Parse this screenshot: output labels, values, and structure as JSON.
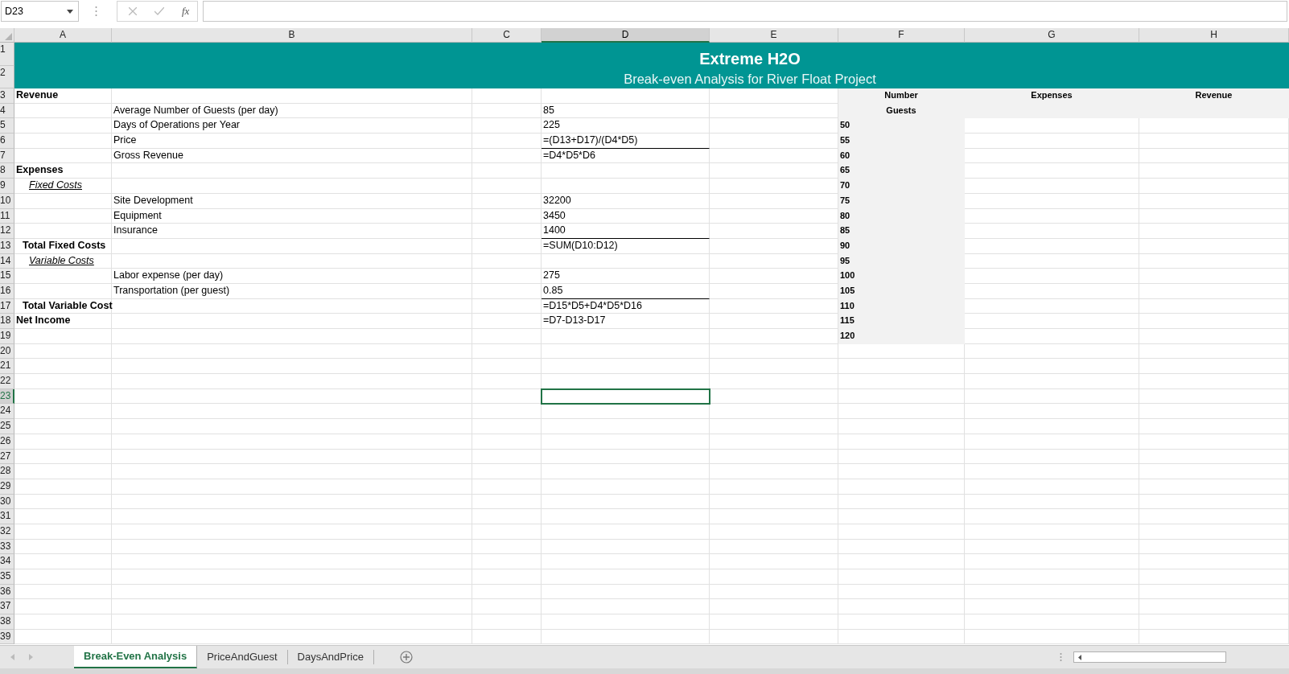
{
  "formula_bar": {
    "name_box": "D23",
    "function_label": "fx"
  },
  "sheet": {
    "title": "Extreme H2O",
    "subtitle": "Break-even Analysis for River Float Project",
    "columns": [
      {
        "letter": "A",
        "selected": false
      },
      {
        "letter": "B",
        "selected": false
      },
      {
        "letter": "C",
        "selected": false
      },
      {
        "letter": "D",
        "selected": true
      },
      {
        "letter": "E",
        "selected": false
      },
      {
        "letter": "F",
        "selected": false
      },
      {
        "letter": "G",
        "selected": false
      },
      {
        "letter": "H",
        "selected": false
      }
    ],
    "rows": [
      {
        "number": "1",
        "selected": false
      },
      {
        "number": "2",
        "selected": false
      },
      {
        "number": "3",
        "selected": false,
        "cells": {
          "A": {
            "text": "Revenue",
            "kind": "heading",
            "bottom_border": false
          },
          "F": {
            "text": "Number",
            "kind": "column_header",
            "bottom_border": false
          },
          "G": {
            "text": "Expenses",
            "kind": "column_header",
            "bottom_border": false
          },
          "H": {
            "text": "Revenue",
            "kind": "column_header",
            "bottom_border": false
          }
        }
      },
      {
        "number": "4",
        "selected": false,
        "cells": {
          "B": {
            "text": "Average Number of Guests (per day)",
            "bottom_border": false
          },
          "D": {
            "text": "85",
            "bottom_border": false
          },
          "F": {
            "text": "Guests",
            "kind": "column_header",
            "bottom_border": false
          }
        }
      },
      {
        "number": "5",
        "selected": false,
        "cells": {
          "B": {
            "text": "Days of Operations per Year",
            "bottom_border": false
          },
          "D": {
            "text": "225",
            "bottom_border": false
          },
          "F": {
            "text": "50",
            "kind": "guest_count",
            "bottom_border": false
          }
        }
      },
      {
        "number": "6",
        "selected": false,
        "cells": {
          "B": {
            "text": "Price",
            "bottom_border": false
          },
          "D": {
            "text": "=(D13+D17)/(D4*D5)",
            "bottom_border": true
          },
          "F": {
            "text": "55",
            "kind": "guest_count",
            "bottom_border": false
          }
        }
      },
      {
        "number": "7",
        "selected": false,
        "cells": {
          "B": {
            "text": "Gross Revenue",
            "bottom_border": false
          },
          "D": {
            "text": "=D4*D5*D6",
            "bottom_border": false
          },
          "F": {
            "text": "60",
            "kind": "guest_count",
            "bottom_border": false
          }
        }
      },
      {
        "number": "8",
        "selected": false,
        "cells": {
          "A": {
            "text": "Expenses",
            "kind": "heading",
            "bottom_border": false
          },
          "F": {
            "text": "65",
            "kind": "guest_count",
            "bottom_border": false
          }
        }
      },
      {
        "number": "9",
        "selected": false,
        "cells": {
          "A": {
            "text": "Fixed Costs",
            "kind": "section",
            "bottom_border": false
          },
          "F": {
            "text": "70",
            "kind": "guest_count",
            "bottom_border": false
          }
        }
      },
      {
        "number": "10",
        "selected": false,
        "cells": {
          "B": {
            "text": "Site Development",
            "bottom_border": false
          },
          "D": {
            "text": "32200",
            "bottom_border": false
          },
          "F": {
            "text": "75",
            "kind": "guest_count",
            "bottom_border": false
          }
        }
      },
      {
        "number": "11",
        "selected": false,
        "cells": {
          "B": {
            "text": "Equipment",
            "bottom_border": false
          },
          "D": {
            "text": "3450",
            "bottom_border": false
          },
          "F": {
            "text": "80",
            "kind": "guest_count",
            "bottom_border": false
          }
        }
      },
      {
        "number": "12",
        "selected": false,
        "cells": {
          "B": {
            "text": "Insurance",
            "bottom_border": false
          },
          "D": {
            "text": "1400",
            "bottom_border": true
          },
          "F": {
            "text": "85",
            "kind": "guest_count",
            "bottom_border": false
          }
        }
      },
      {
        "number": "13",
        "selected": false,
        "cells": {
          "A": {
            "text": "Total Fixed Costs",
            "kind": "subtotal",
            "bottom_border": false
          },
          "D": {
            "text": "=SUM(D10:D12)",
            "bottom_border": false
          },
          "F": {
            "text": "90",
            "kind": "guest_count",
            "bottom_border": false
          }
        }
      },
      {
        "number": "14",
        "selected": false,
        "cells": {
          "A": {
            "text": "Variable Costs",
            "kind": "section",
            "bottom_border": false
          },
          "F": {
            "text": "95",
            "kind": "guest_count",
            "bottom_border": false
          }
        }
      },
      {
        "number": "15",
        "selected": false,
        "cells": {
          "B": {
            "text": "Labor expense (per day)",
            "bottom_border": false
          },
          "D": {
            "text": "275",
            "bottom_border": false
          },
          "F": {
            "text": "100",
            "kind": "guest_count",
            "bottom_border": false
          }
        }
      },
      {
        "number": "16",
        "selected": false,
        "cells": {
          "B": {
            "text": "Transportation (per guest)",
            "bottom_border": false
          },
          "D": {
            "text": "0.85",
            "bottom_border": true
          },
          "F": {
            "text": "105",
            "kind": "guest_count",
            "bottom_border": false
          }
        }
      },
      {
        "number": "17",
        "selected": false,
        "cells": {
          "A": {
            "text": "Total Variable Cost",
            "kind": "subtotal",
            "bottom_border": false
          },
          "D": {
            "text": "=D15*D5+D4*D5*D16",
            "bottom_border": false
          },
          "F": {
            "text": "110",
            "kind": "guest_count",
            "bottom_border": false
          }
        }
      },
      {
        "number": "18",
        "selected": false,
        "cells": {
          "A": {
            "text": "Net Income",
            "kind": "heading",
            "bottom_border": false
          },
          "D": {
            "text": "=D7-D13-D17",
            "bottom_border": false
          },
          "F": {
            "text": "115",
            "kind": "guest_count",
            "bottom_border": false
          }
        }
      },
      {
        "number": "19",
        "selected": false,
        "cells": {
          "F": {
            "text": "120",
            "kind": "guest_count",
            "bottom_border": false
          }
        }
      },
      {
        "number": "20",
        "selected": false
      },
      {
        "number": "21",
        "selected": false
      },
      {
        "number": "22",
        "selected": false
      },
      {
        "number": "23",
        "selected": true
      },
      {
        "number": "24",
        "selected": false
      },
      {
        "number": "25",
        "selected": false
      },
      {
        "number": "26",
        "selected": false
      },
      {
        "number": "27",
        "selected": false
      },
      {
        "number": "28",
        "selected": false
      },
      {
        "number": "29",
        "selected": false
      },
      {
        "number": "30",
        "selected": false
      },
      {
        "number": "31",
        "selected": false
      },
      {
        "number": "32",
        "selected": false
      },
      {
        "number": "33",
        "selected": false
      },
      {
        "number": "34",
        "selected": false
      },
      {
        "number": "35",
        "selected": false
      },
      {
        "number": "36",
        "selected": false
      },
      {
        "number": "37",
        "selected": false
      },
      {
        "number": "38",
        "selected": false
      },
      {
        "number": "39",
        "selected": false
      }
    ]
  },
  "sheet_tabs": [
    {
      "label": "Break-Even Analysis",
      "selected": true
    },
    {
      "label": "PriceAndGuest",
      "selected": false
    },
    {
      "label": "DaysAndPrice",
      "selected": false
    }
  ]
}
